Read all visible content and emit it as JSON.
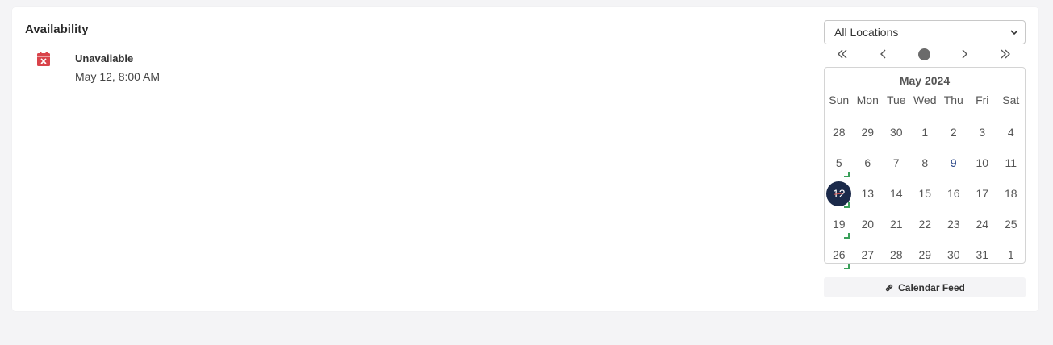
{
  "panel": {
    "title": "Availability",
    "entries": [
      {
        "status": "Unavailable",
        "time": "May 12, 8:00 AM",
        "icon": "calendar-x-icon",
        "icon_color": "#d9434a"
      }
    ]
  },
  "location_select": {
    "selected": "All Locations"
  },
  "calendar_nav": {
    "prev_year": "«",
    "prev_month": "‹",
    "next_month": "›",
    "next_year": "»"
  },
  "calendar": {
    "month_label": "May 2024",
    "weekdays": [
      "Sun",
      "Mon",
      "Tue",
      "Wed",
      "Thu",
      "Fri",
      "Sat"
    ],
    "weeks": [
      [
        "28",
        "29",
        "30",
        "1",
        "2",
        "3",
        "4"
      ],
      [
        "5",
        "6",
        "7",
        "8",
        "9",
        "10",
        "11"
      ],
      [
        "12",
        "13",
        "14",
        "15",
        "16",
        "17",
        "18"
      ],
      [
        "19",
        "20",
        "21",
        "22",
        "23",
        "24",
        "25"
      ],
      [
        "26",
        "27",
        "28",
        "29",
        "30",
        "31",
        "1"
      ]
    ],
    "today": "9",
    "selected": "12",
    "marked_days": [
      "5",
      "12",
      "19",
      "26"
    ],
    "selected_color": "#1b2a4a",
    "mark_color": "#3aa05a"
  },
  "feed_button": {
    "label": "Calendar Feed",
    "icon": "link-icon"
  }
}
